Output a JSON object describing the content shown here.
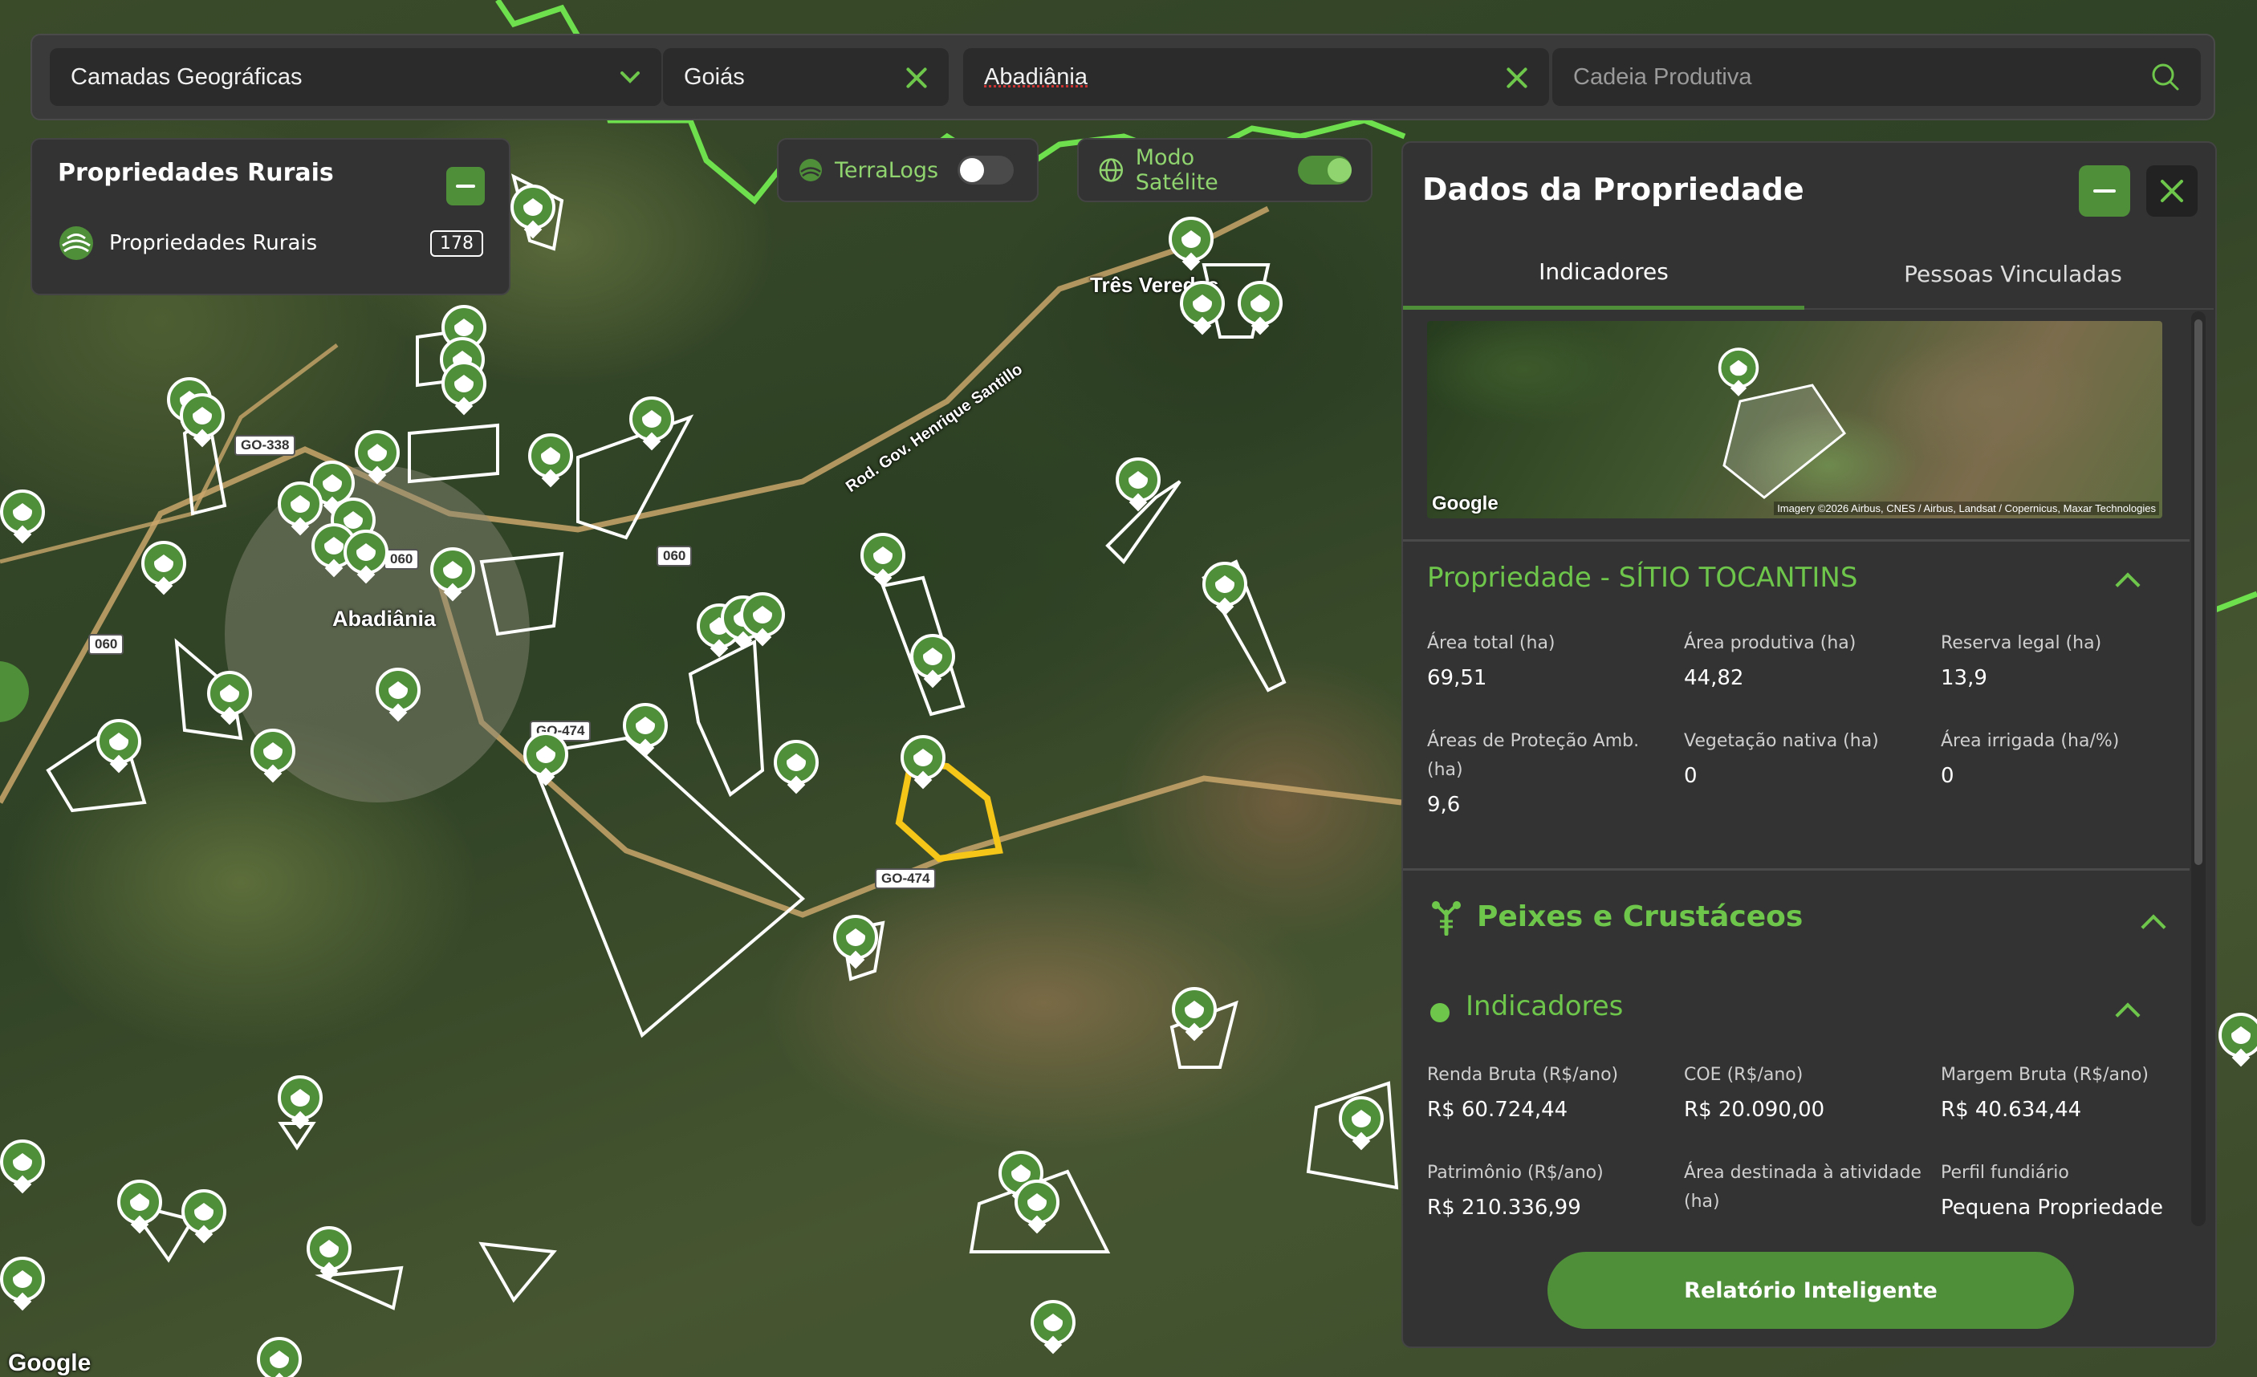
{
  "topbar": {
    "layers_select": "Camadas Geográficas",
    "state_value": "Goiás",
    "city_value": "Abadiânia",
    "search_placeholder": "Cadeia Produtiva"
  },
  "layers_card": {
    "title": "Propriedades Rurais",
    "item_label": "Propriedades Rurais",
    "item_count": "178"
  },
  "toggles": {
    "terralogs_label": "TerraLogs",
    "terralogs_on": false,
    "satellite_label": "Modo Satélite",
    "satellite_on": true
  },
  "map": {
    "labels": {
      "city": "Abadiânia",
      "town": "Três Veredas",
      "road_name": "Rod. Gov. Henrique Santillo"
    },
    "shields": [
      "GO-338",
      "060",
      "060",
      "060",
      "GO-474",
      "GO-474"
    ],
    "attribution": "Google"
  },
  "panel": {
    "title": "Dados da Propriedade",
    "tabs": [
      "Indicadores",
      "Pessoas Vinculadas"
    ],
    "active_tab": "Indicadores",
    "thumbnail": {
      "logo": "Google",
      "attribution": "Imagery ©2026 Airbus, CNES / Airbus, Landsat / Copernicus, Maxar Technologies"
    },
    "property_title": "Propriedade - SÍTIO TOCANTINS",
    "property_metrics": [
      {
        "label": "Área total (ha)",
        "value": "69,51"
      },
      {
        "label": "Área produtiva (ha)",
        "value": "44,82"
      },
      {
        "label": "Reserva legal (ha)",
        "value": "13,9"
      },
      {
        "label": "Áreas de Proteção Amb. (ha)",
        "value": "9,6"
      },
      {
        "label": "Vegetação nativa (ha)",
        "value": "0"
      },
      {
        "label": "Área irrigada (ha/%)",
        "value": "0"
      }
    ],
    "chain_title": "Peixes e Crustáceos",
    "indicators_title": "Indicadores",
    "indicator_metrics": [
      {
        "label": "Renda Bruta (R$/ano)",
        "value": "R$ 60.724,44"
      },
      {
        "label": "COE (R$/ano)",
        "value": "R$ 20.090,00"
      },
      {
        "label": "Margem Bruta (R$/ano)",
        "value": "R$ 40.634,44"
      },
      {
        "label": "Patrimônio (R$/ano)",
        "value": "R$ 210.336,99"
      },
      {
        "label": "Área destinada à atividade (ha)",
        "value": ""
      },
      {
        "label": "Perfil fundiário",
        "value": "Pequena Propriedade"
      }
    ],
    "report_button": "Relatório Inteligente"
  },
  "colors": {
    "accent": "#4f8f3a",
    "accent_light": "#6ec74b",
    "selected_polygon": "#f5c518",
    "panel_bg": "#333333"
  },
  "icons": [
    "chevron-down-icon",
    "close-icon",
    "search-icon",
    "minus-icon",
    "leaf-globe-icon",
    "globe-icon",
    "crayfish-icon",
    "map-pin-icon"
  ]
}
